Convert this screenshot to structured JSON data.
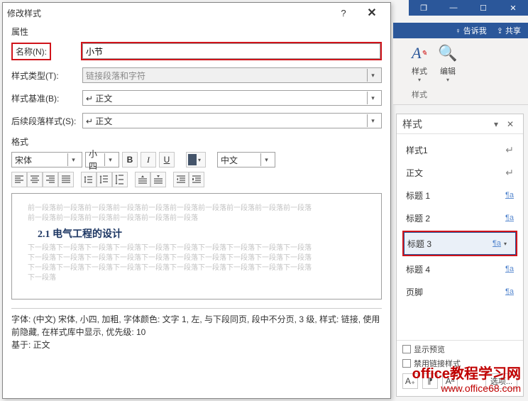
{
  "dialog": {
    "title": "修改样式",
    "sections": {
      "props": "属性",
      "format": "格式"
    },
    "labels": {
      "name": "名称(N):",
      "type": "样式类型(T):",
      "based": "样式基准(B):",
      "next": "后续段落样式(S):"
    },
    "values": {
      "name": "小节",
      "type": "链接段落和字符",
      "based": "↵ 正文",
      "next": "↵ 正文"
    },
    "format_bar": {
      "font": "宋体",
      "size": "小四",
      "bold": "B",
      "italic": "I",
      "underline": "U",
      "lang": "中文"
    },
    "preview": {
      "grey_before": "前一段落前一段落前一段落前一段落前一段落前一段落前一段落前一段落前一段落前一段落\n前一段落前一段落前一段落前一段落前一段落前一段落",
      "sample": "2.1 电气工程的设计",
      "grey_after": "下一段落下一段落下一段落下一段落下一段落下一段落下一段落下一段落下一段落下一段落\n下一段落下一段落下一段落下一段落下一段落下一段落下一段落下一段落下一段落下一段落\n下一段落下一段落下一段落下一段落下一段落下一段落下一段落下一段落下一段落下一段落\n下一段落"
    },
    "desc": "字体: (中文) 宋体, 小四, 加粗, 字体颜色: 文字 1, 左, 与下段同页, 段中不分页, 3 级, 样式: 链接, 使用前隐藏, 在样式库中显示, 优先级: 10\n    基于: 正文"
  },
  "ribbon": {
    "tell_me": "告诉我",
    "share": "共享",
    "styles": "样式",
    "edit": "编辑",
    "group_label": "样式"
  },
  "pane": {
    "title": "样式",
    "items": [
      {
        "name": "样式1",
        "mark": "↵",
        "cls": "ret"
      },
      {
        "name": "正文",
        "mark": "↵",
        "cls": "ret"
      },
      {
        "name": "标题 1",
        "mark": "¶a",
        "cls": ""
      },
      {
        "name": "标题 2",
        "mark": "¶a",
        "cls": ""
      },
      {
        "name": "标题 3",
        "mark": "¶a",
        "cls": "",
        "selected": true
      },
      {
        "name": "标题 4",
        "mark": "¶a",
        "cls": ""
      },
      {
        "name": "页脚",
        "mark": "¶a",
        "cls": ""
      }
    ],
    "show_preview": "显示预览",
    "disable_linked": "禁用链接样式",
    "options": "选项..."
  },
  "watermark": {
    "l1": "office教程学习网",
    "l2": "www.office68.com"
  }
}
